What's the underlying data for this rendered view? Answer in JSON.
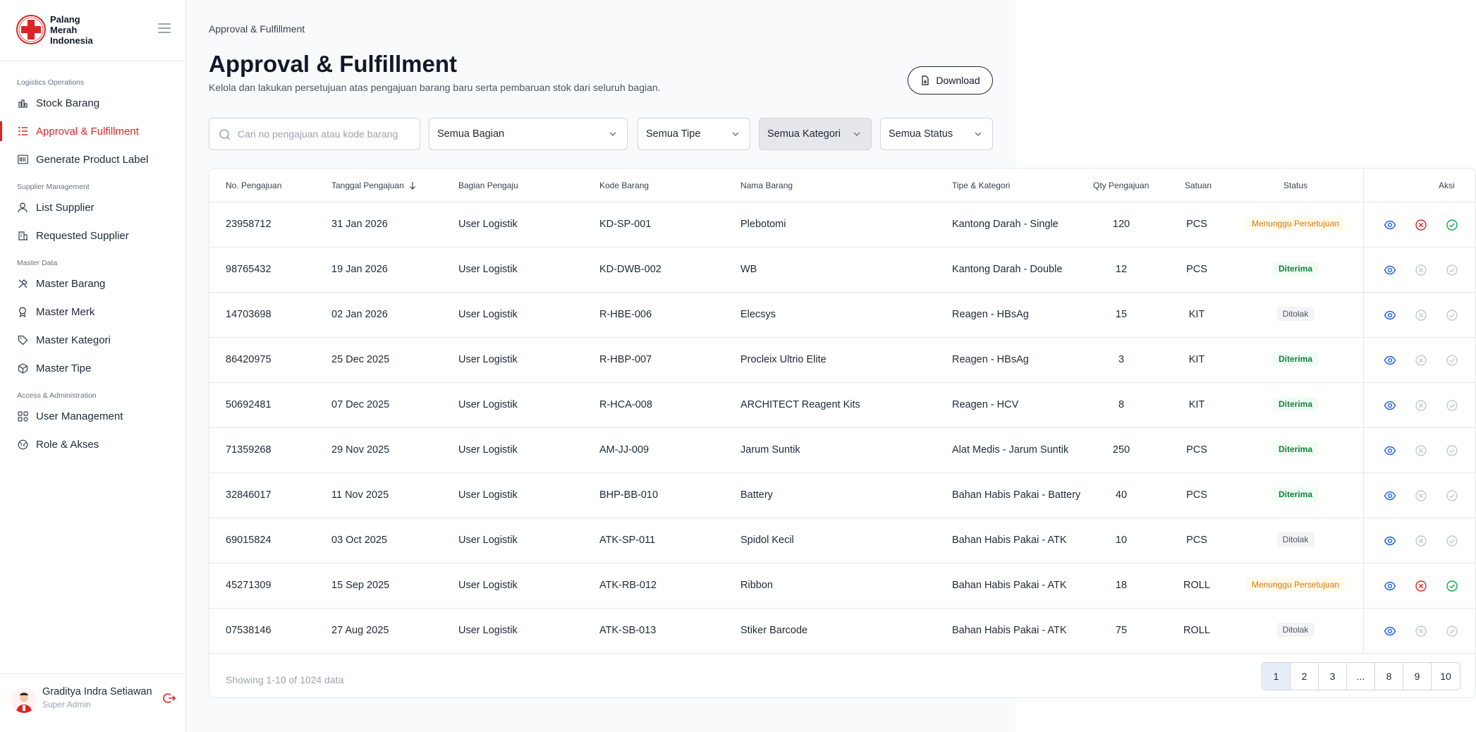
{
  "brand": {
    "name_lines": [
      "Palang",
      "Merah",
      "Indonesia"
    ]
  },
  "sidebar": {
    "sections": [
      {
        "title": "Logistics Operations"
      },
      {
        "title": "Supplier Management"
      },
      {
        "title": "Master Data"
      },
      {
        "title": "Access & Administration"
      }
    ],
    "items": [
      {
        "label": "Stock Barang",
        "icon": "bar-chart-icon"
      },
      {
        "label": "Approval & Fulfillment",
        "icon": "list-check-icon",
        "active": true
      },
      {
        "label": "Generate Product Label",
        "icon": "barcode-icon"
      },
      {
        "label": "List Supplier",
        "icon": "user-icon"
      },
      {
        "label": "Requested Supplier",
        "icon": "building-icon"
      },
      {
        "label": "Master Barang",
        "icon": "tools-icon"
      },
      {
        "label": "Master Merk",
        "icon": "award-icon"
      },
      {
        "label": "Master Kategori",
        "icon": "tag-icon"
      },
      {
        "label": "Master Tipe",
        "icon": "box-icon"
      },
      {
        "label": "User Management",
        "icon": "grid-users-icon"
      },
      {
        "label": "Role & Akses",
        "icon": "globe-icon"
      }
    ]
  },
  "user": {
    "name": "Graditya Indra Setiawan",
    "role": "Super Admin"
  },
  "page": {
    "breadcrumb": "Approval & Fulfillment",
    "title": "Approval & Fulfillment",
    "subtitle": "Kelola dan lakukan persetujuan atas pengajuan barang baru serta pembaruan stok dari seluruh bagian.",
    "download_label": "Download"
  },
  "filters": {
    "search_placeholder": "Cari no pengajuan atau kode barang",
    "bagian": "Semua Bagian",
    "tipe": "Semua Tipe",
    "kategori": "Semua Kategori",
    "status": "Semua Status"
  },
  "table": {
    "headers": {
      "no": "No. Pengajuan",
      "tanggal": "Tanggal Pengajuan",
      "bagian": "Bagian Pengaju",
      "kode": "Kode Barang",
      "nama": "Nama Barang",
      "tipe": "Tipe & Kategori",
      "qty": "Qty Pengajuan",
      "satuan": "Satuan",
      "status": "Status",
      "aksi": "Aksi"
    },
    "rows": [
      {
        "no": "23958712",
        "tanggal": "31 Jan 2026",
        "bagian": "User Logistik",
        "kode": "KD-SP-001",
        "nama": "Plebotomi",
        "tipe": "Kantong Darah - Single",
        "qty": "120",
        "satuan": "PCS",
        "status": "Menunggu Persetujuan",
        "status_kind": "pending"
      },
      {
        "no": "98765432",
        "tanggal": "19 Jan 2026",
        "bagian": "User Logistik",
        "kode": "KD-DWB-002",
        "nama": "WB",
        "tipe": "Kantong Darah - Double",
        "qty": "12",
        "satuan": "PCS",
        "status": "Diterima",
        "status_kind": "ok"
      },
      {
        "no": "14703698",
        "tanggal": "02 Jan 2026",
        "bagian": "User Logistik",
        "kode": "R-HBE-006",
        "nama": "Elecsys",
        "tipe": "Reagen - HBsAg",
        "qty": "15",
        "satuan": "KIT",
        "status": "Ditolak",
        "status_kind": "no"
      },
      {
        "no": "86420975",
        "tanggal": "25 Dec 2025",
        "bagian": "User Logistik",
        "kode": "R-HBP-007",
        "nama": "Procleix Ultrio Elite",
        "tipe": "Reagen - HBsAg",
        "qty": "3",
        "satuan": "KIT",
        "status": "Diterima",
        "status_kind": "ok"
      },
      {
        "no": "50692481",
        "tanggal": "07 Dec 2025",
        "bagian": "User Logistik",
        "kode": "R-HCA-008",
        "nama": "ARCHITECT Reagent Kits",
        "tipe": "Reagen - HCV",
        "qty": "8",
        "satuan": "KIT",
        "status": "Diterima",
        "status_kind": "ok"
      },
      {
        "no": "71359268",
        "tanggal": "29 Nov 2025",
        "bagian": "User Logistik",
        "kode": "AM-JJ-009",
        "nama": "Jarum Suntik",
        "tipe": "Alat Medis - Jarum Suntik",
        "qty": "250",
        "satuan": "PCS",
        "status": "Diterima",
        "status_kind": "ok"
      },
      {
        "no": "32846017",
        "tanggal": "11 Nov 2025",
        "bagian": "User Logistik",
        "kode": "BHP-BB-010",
        "nama": "Battery",
        "tipe": "Bahan Habis Pakai - Battery",
        "qty": "40",
        "satuan": "PCS",
        "status": "Diterima",
        "status_kind": "ok"
      },
      {
        "no": "69015824",
        "tanggal": "03 Oct 2025",
        "bagian": "User Logistik",
        "kode": "ATK-SP-011",
        "nama": "Spidol Kecil",
        "tipe": "Bahan Habis Pakai - ATK",
        "qty": "10",
        "satuan": "PCS",
        "status": "Ditolak",
        "status_kind": "no"
      },
      {
        "no": "45271309",
        "tanggal": "15 Sep 2025",
        "bagian": "User Logistik",
        "kode": "ATK-RB-012",
        "nama": "Ribbon",
        "tipe": "Bahan Habis Pakai - ATK",
        "qty": "18",
        "satuan": "ROLL",
        "status": "Menunggu Persetujuan",
        "status_kind": "pending"
      },
      {
        "no": "07538146",
        "tanggal": "27 Aug 2025",
        "bagian": "User Logistik",
        "kode": "ATK-SB-013",
        "nama": "Stiker Barcode",
        "tipe": "Bahan Habis Pakai - ATK",
        "qty": "75",
        "satuan": "ROLL",
        "status": "Ditolak",
        "status_kind": "no"
      }
    ],
    "showing": "Showing 1-10 of 1024 data",
    "pages": [
      "1",
      "2",
      "3",
      "...",
      "8",
      "9",
      "10"
    ],
    "current_page": "1"
  },
  "colors": {
    "accent": "#dc2626",
    "pending": "#d97706",
    "ok": "#15803d",
    "view": "#2563eb"
  }
}
